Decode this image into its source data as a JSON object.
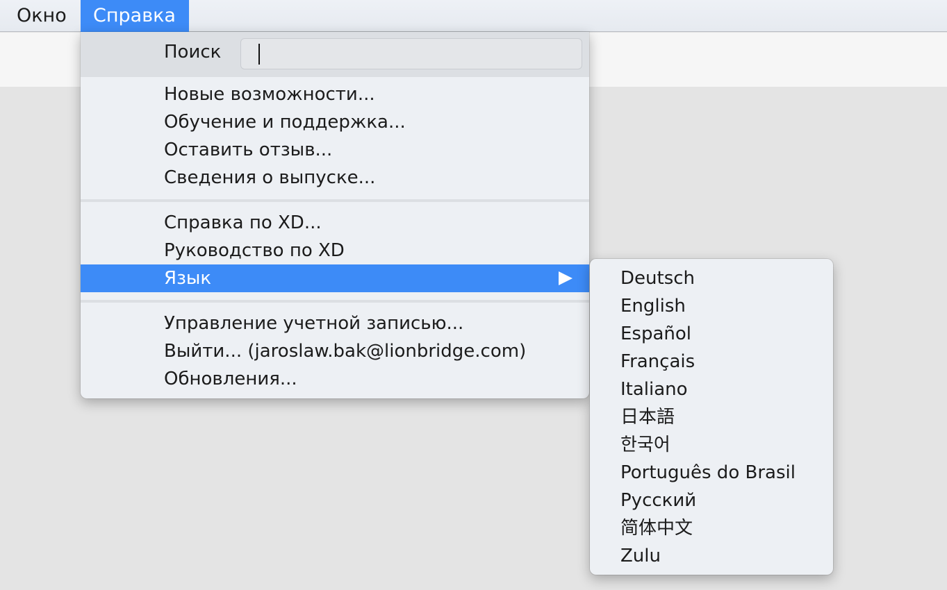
{
  "menubar": {
    "items": [
      "Окно",
      "Справка"
    ]
  },
  "help_menu": {
    "search_label": "Поиск",
    "search_value": "",
    "group1": [
      "Новые возможности...",
      "Обучение и поддержка...",
      "Оставить отзыв...",
      "Сведения о выпуске..."
    ],
    "group2": [
      "Справка по XD...",
      "Руководство по XD",
      "Язык"
    ],
    "group3": [
      "Управление учетной записью...",
      "Выйти... (jaroslaw.bak@lionbridge.com)",
      "Обновления..."
    ]
  },
  "language_submenu": {
    "items": [
      "Deutsch",
      "English",
      "Español",
      "Français",
      "Italiano",
      "日本語",
      "한국어",
      "Português do Brasil",
      "Русский",
      "简体中文",
      "Zulu"
    ]
  },
  "colors": {
    "highlight": "#3d8bf7",
    "menu_bg": "#edf0f4",
    "search_bg": "#dcdfe3"
  },
  "icons": {
    "submenu_arrow": "triangle-right-icon"
  }
}
